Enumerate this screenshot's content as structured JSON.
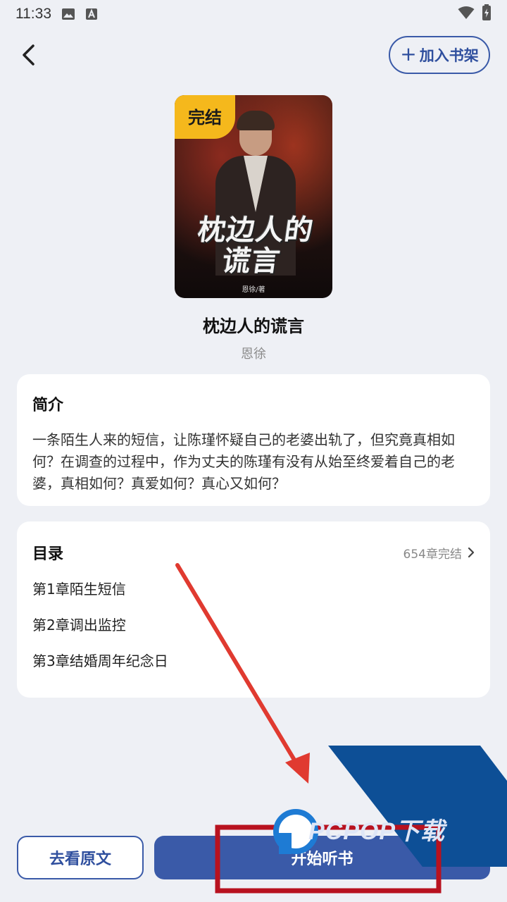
{
  "status_bar": {
    "time": "11:33",
    "icons": [
      "image-icon",
      "text-a-icon",
      "wifi-icon",
      "battery-charging-icon"
    ]
  },
  "header": {
    "back_icon": "chevron-left-icon",
    "add_shelf_label": "加入书架",
    "add_shelf_icon": "plus-icon"
  },
  "book": {
    "cover_badge": "完结",
    "cover_title_line1": "枕边人的",
    "cover_title_line2": "谎言",
    "cover_author": "恩徐/著",
    "title": "枕边人的谎言",
    "author": "恩徐"
  },
  "intro": {
    "heading": "简介",
    "text": "一条陌生人来的短信，让陈瑾怀疑自己的老婆出轨了，但究竟真相如何？在调查的过程中，作为丈夫的陈瑾有没有从始至终爱着自己的老婆，真相如何？真爱如何？真心又如何？"
  },
  "toc": {
    "heading": "目录",
    "meta": "654章完结",
    "chapters": [
      "第1章陌生短信",
      "第2章调出监控",
      "第3章结婚周年纪念日"
    ]
  },
  "actions": {
    "original_label": "去看原文",
    "listen_label": "开始听书"
  },
  "watermark": {
    "text": "PCPOP下载"
  },
  "colors": {
    "accent": "#3a5aa8",
    "background": "#eef0f5",
    "badge": "#f5b81c",
    "annotation_red": "#e03a30",
    "highlight_box": "#b8121f",
    "watermark_blue": "#0d4f96"
  }
}
